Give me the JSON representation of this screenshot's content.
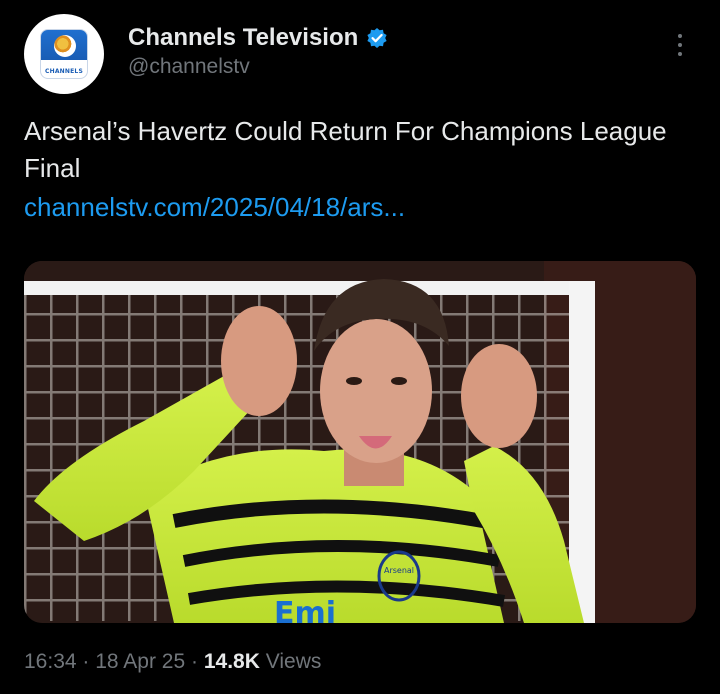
{
  "author": {
    "display_name": "Channels Television",
    "handle": "@channelstv",
    "verified": true,
    "avatar_logo_text": "CHANNELS"
  },
  "tweet": {
    "text": "Arsenal’s Havertz Could Return For Champions League Final",
    "link": "channelstv.com/2025/04/18/ars..."
  },
  "media": {
    "jersey_texts": [
      "Arsenal",
      "Emi"
    ]
  },
  "meta": {
    "time": "16:34",
    "separator": "·",
    "date": "18 Apr 25",
    "views_count": "14.8K",
    "views_label": "Views"
  },
  "colors": {
    "background": "#000000",
    "primary_text": "#e7e9ea",
    "secondary_text": "#71767b",
    "link": "#1d9bf0",
    "verified_badge": "#1d9bf0"
  },
  "icons": {
    "verified": "verified-badge-icon",
    "more": "more-vertical-icon"
  }
}
